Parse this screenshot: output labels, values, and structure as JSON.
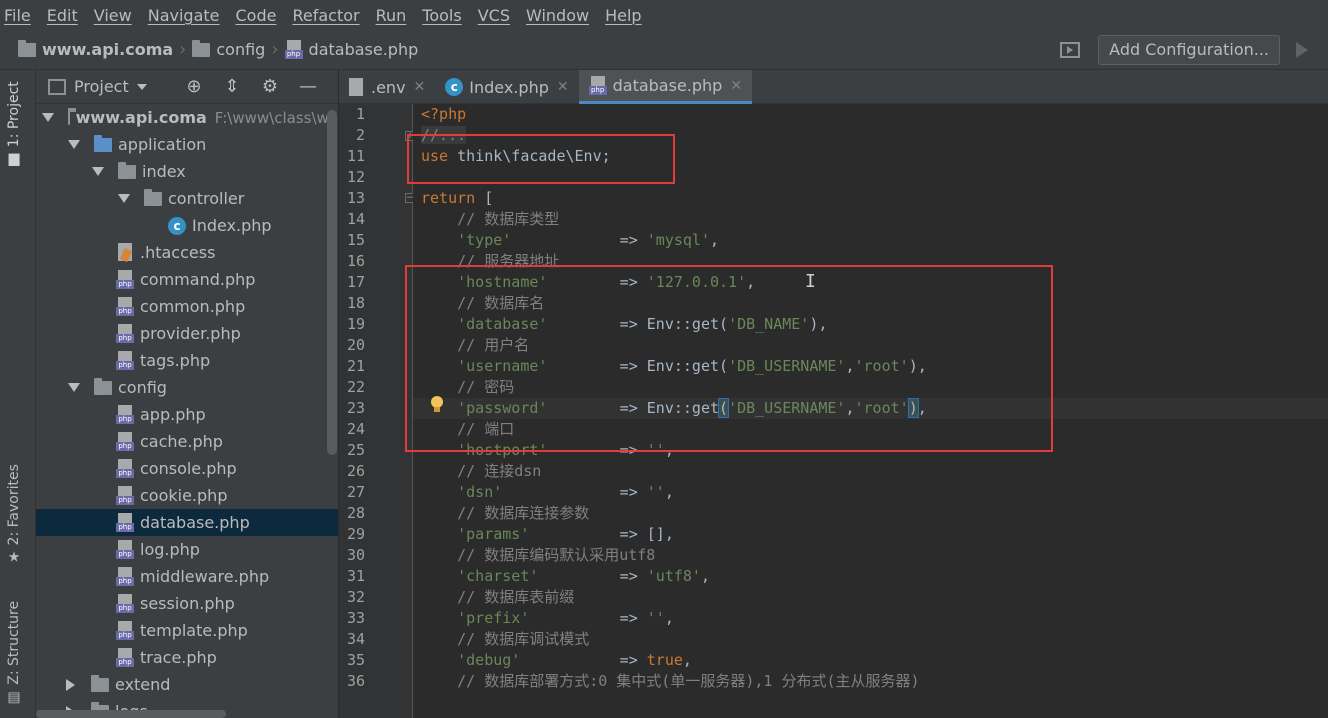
{
  "menu": [
    "File",
    "Edit",
    "View",
    "Navigate",
    "Code",
    "Refactor",
    "Run",
    "Tools",
    "VCS",
    "Window",
    "Help"
  ],
  "nav": {
    "project": "www.api.coma",
    "folder": "config",
    "file": "database.php",
    "add_config": "Add Configuration..."
  },
  "side_tabs": {
    "project": "1: Project",
    "favorites": "2: Favorites",
    "structure": "Z: Structure"
  },
  "project_panel": {
    "title": "Project",
    "tool_icons": [
      "target-icon",
      "collapse-icon",
      "gear-icon",
      "minimize-icon"
    ]
  },
  "tree": {
    "root": "www.api.coma",
    "root_path": "F:\\www\\class\\we",
    "application": "application",
    "index": "index",
    "controller": "controller",
    "index_php": "Index.php",
    "htaccess": ".htaccess",
    "command": "command.php",
    "common": "common.php",
    "provider": "provider.php",
    "tags": "tags.php",
    "config": "config",
    "config_files": [
      "app.php",
      "cache.php",
      "console.php",
      "cookie.php",
      "database.php",
      "log.php",
      "middleware.php",
      "session.php",
      "template.php",
      "trace.php"
    ],
    "extend": "extend",
    "logs": "logs"
  },
  "tabs": [
    ".env",
    "Index.php",
    "database.php"
  ],
  "editor": {
    "lines": [
      {
        "n": "1",
        "t": "<?php"
      },
      {
        "n": "2",
        "t": "//..."
      },
      {
        "n": "11",
        "t": "use think\\facade\\Env;"
      },
      {
        "n": "12",
        "t": ""
      },
      {
        "n": "13",
        "t": "return ["
      },
      {
        "n": "14",
        "t": "    // 数据库类型"
      },
      {
        "n": "15",
        "t": "    'type'            => 'mysql',"
      },
      {
        "n": "16",
        "t": "    // 服务器地址"
      },
      {
        "n": "17",
        "t": "    'hostname'        => '127.0.0.1',"
      },
      {
        "n": "18",
        "t": "    // 数据库名"
      },
      {
        "n": "19",
        "t": "    'database'        => Env::get('DB_NAME'),"
      },
      {
        "n": "20",
        "t": "    // 用户名"
      },
      {
        "n": "21",
        "t": "    'username'        => Env::get('DB_USERNAME','root'),"
      },
      {
        "n": "22",
        "t": "    // 密码"
      },
      {
        "n": "23",
        "t": "    'password'        => Env::get('DB_USERNAME','root'),"
      },
      {
        "n": "24",
        "t": "    // 端口"
      },
      {
        "n": "25",
        "t": "    'hostport'        => '',"
      },
      {
        "n": "26",
        "t": "    // 连接dsn"
      },
      {
        "n": "27",
        "t": "    'dsn'             => '',"
      },
      {
        "n": "28",
        "t": "    // 数据库连接参数"
      },
      {
        "n": "29",
        "t": "    'params'          => [],"
      },
      {
        "n": "30",
        "t": "    // 数据库编码默认采用utf8"
      },
      {
        "n": "31",
        "t": "    'charset'         => 'utf8',"
      },
      {
        "n": "32",
        "t": "    // 数据库表前缀"
      },
      {
        "n": "33",
        "t": "    'prefix'          => '',"
      },
      {
        "n": "34",
        "t": "    // 数据库调试模式"
      },
      {
        "n": "35",
        "t": "    'debug'           => true,"
      },
      {
        "n": "36",
        "t": "    // 数据库部署方式:0 集中式(单一服务器),1 分布式(主从服务器)"
      }
    ]
  },
  "colors": {
    "keyword": "#cc7832",
    "string": "#6a8759",
    "comment": "#808080",
    "highlight_box": "#e23b3b",
    "selected_tree": "#0d293e"
  }
}
